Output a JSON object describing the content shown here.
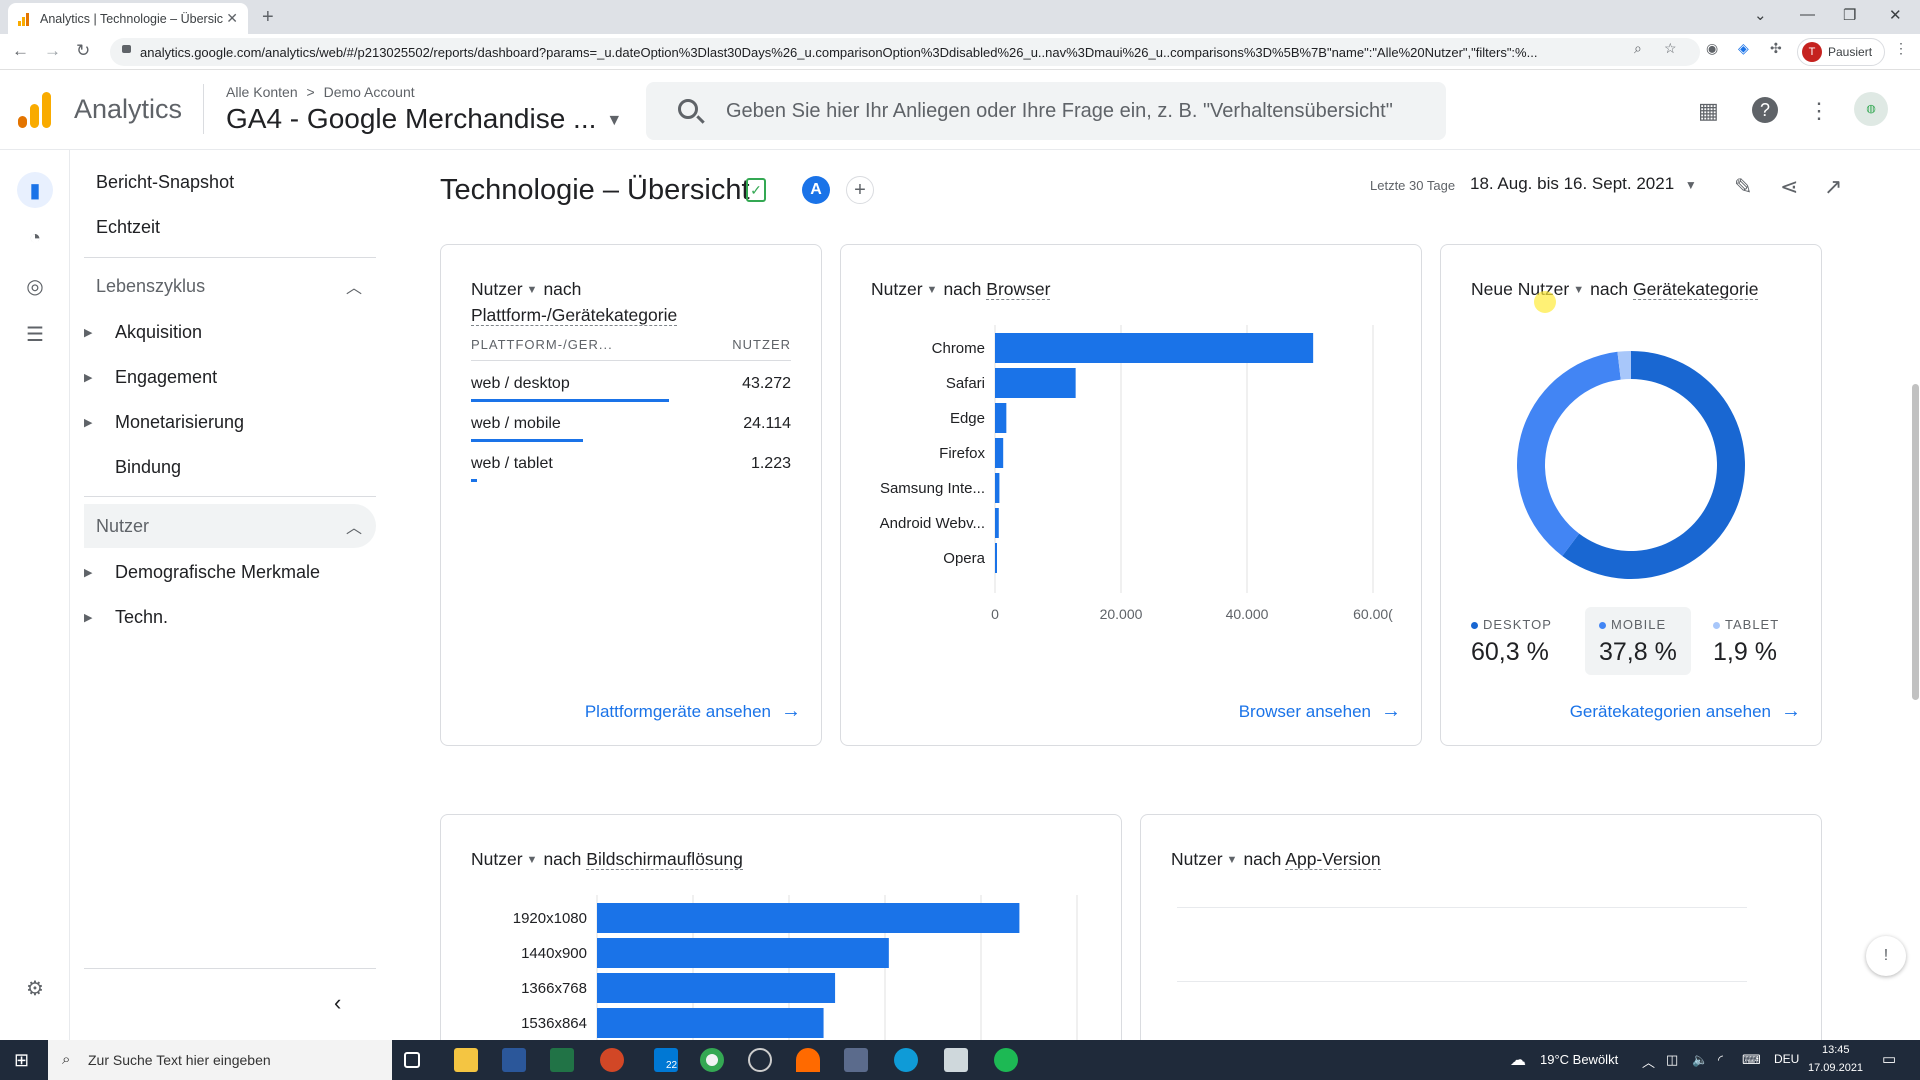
{
  "browser": {
    "tab_title": "Analytics | Technologie – Übersic",
    "url": "analytics.google.com/analytics/web/#/p213025502/reports/dashboard?params=_u.dateOption%3Dlast30Days%26_u.comparisonOption%3Ddisabled%26_u..nav%3Dmaui%26_u..comparisons%3D%5B%7B\"name\":\"Alle%20Nutzer\",\"filters\":%...",
    "profile_initial": "T",
    "profile_status": "Pausiert"
  },
  "header": {
    "app_name": "Analytics",
    "breadcrumb_account": "Alle Konten",
    "breadcrumb_sep": ">",
    "breadcrumb_property": "Demo Account",
    "property_name": "GA4 - Google Merchandise ...",
    "search_placeholder": "Geben Sie hier Ihr Anliegen oder Ihre Frage ein, z. B. \"Verhaltensübersicht\""
  },
  "sidebar": {
    "snapshot": "Bericht-Snapshot",
    "realtime": "Echtzeit",
    "lifecycle_label": "Lebenszyklus",
    "lifecycle_items": [
      "Akquisition",
      "Engagement",
      "Monetarisierung",
      "Bindung"
    ],
    "user_label": "Nutzer",
    "user_items": [
      "Demografische Merkmale",
      "Techn."
    ]
  },
  "page": {
    "title": "Technologie – Übersicht",
    "comparison_badge": "A",
    "date_label": "Letzte 30 Tage",
    "date_range": "18. Aug. bis 16. Sept. 2021"
  },
  "card_platform": {
    "metric": "Nutzer",
    "connector": "nach",
    "dimension": "Plattform-/Gerätekategorie",
    "col_dim": "PLATTFORM-/GER...",
    "col_metric": "NUTZER",
    "rows": [
      {
        "label": "web / desktop",
        "value": "43.272",
        "share": 0.62
      },
      {
        "label": "web / mobile",
        "value": "24.114",
        "share": 0.35
      },
      {
        "label": "web / tablet",
        "value": "1.223",
        "share": 0.02
      }
    ],
    "link": "Plattformgeräte ansehen"
  },
  "card_browser": {
    "metric": "Nutzer",
    "connector": "nach",
    "dimension": "Browser",
    "link": "Browser ansehen"
  },
  "card_device": {
    "metric": "Neue Nutzer",
    "connector": "nach",
    "dimension": "Gerätekategorie",
    "link": "Gerätekategorien ansehen",
    "legend": [
      {
        "label": "DESKTOP",
        "pct": "60,3 %",
        "color": "#1967d2"
      },
      {
        "label": "MOBILE",
        "pct": "37,8 %",
        "color": "#4285f4"
      },
      {
        "label": "TABLET",
        "pct": "1,9 %",
        "color": "#a8c7fa"
      }
    ]
  },
  "card_resolution": {
    "metric": "Nutzer",
    "connector": "nach",
    "dimension": "Bildschirmauflösung"
  },
  "card_appversion": {
    "metric": "Nutzer",
    "connector": "nach",
    "dimension": "App-Version"
  },
  "chart_data": [
    {
      "type": "bar",
      "orientation": "horizontal",
      "categories": [
        "Chrome",
        "Safari",
        "Edge",
        "Firefox",
        "Samsung Inte...",
        "Android Webv...",
        "Opera"
      ],
      "values": [
        50500,
        12800,
        1800,
        1300,
        700,
        600,
        300
      ],
      "xticks": [
        "0",
        "20.000",
        "40.000",
        "60.00("
      ],
      "xlim": [
        0,
        60000
      ],
      "color": "#1a73e8"
    },
    {
      "type": "pie",
      "categories": [
        "DESKTOP",
        "MOBILE",
        "TABLET"
      ],
      "values": [
        60.3,
        37.8,
        1.9
      ],
      "colors": [
        "#1967d2",
        "#4285f4",
        "#a8c7fa"
      ]
    },
    {
      "type": "bar",
      "orientation": "horizontal",
      "categories": [
        "1920x1080",
        "1440x900",
        "1366x768",
        "1536x864"
      ],
      "values": [
        22000,
        15200,
        12400,
        11800
      ],
      "xlim": [
        0,
        25000
      ],
      "color": "#1a73e8"
    }
  ],
  "taskbar": {
    "search_placeholder": "Zur Suche Text hier eingeben",
    "mail_badge": "22",
    "weather": "19°C  Bewölkt",
    "lang": "DEU",
    "time": "13:45",
    "date": "17.09.2021"
  },
  "colors": {
    "accent": "#1a73e8",
    "brand_orange": "#f9ab00",
    "brand_dark": "#e37400"
  }
}
